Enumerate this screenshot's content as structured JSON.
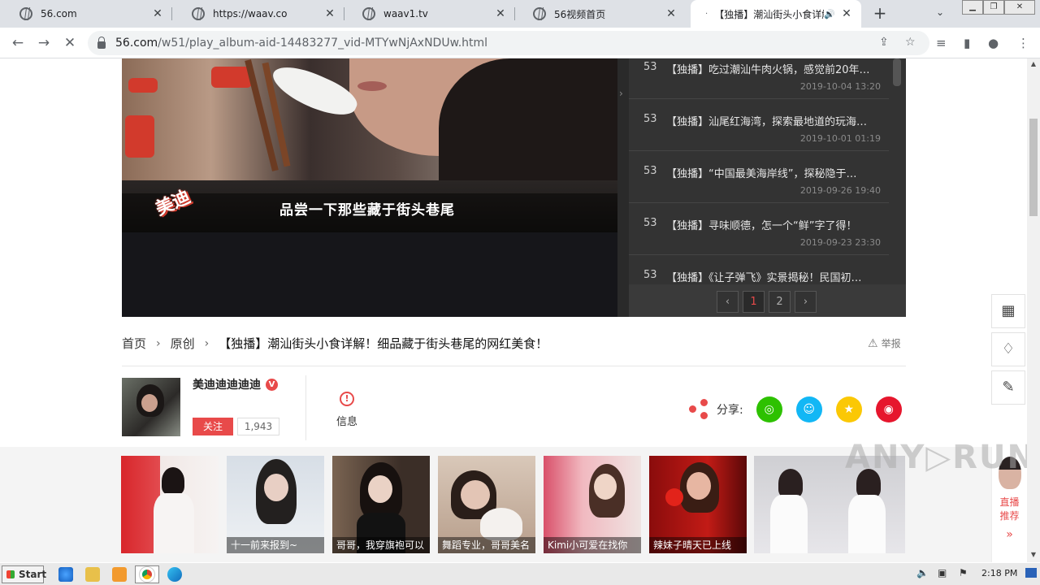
{
  "browser": {
    "tabs": [
      {
        "title": "56.com",
        "active": false
      },
      {
        "title": "https://waav.co",
        "active": false
      },
      {
        "title": "waav1.tv",
        "active": false
      },
      {
        "title": "56视频首页",
        "active": false
      },
      {
        "title": "【独播】潮汕街头小食详解",
        "active": true
      }
    ],
    "url_domain": "56.com",
    "url_path": "/w51/play_album-aid-14483277_vid-MTYwNjAxNDUw.html"
  },
  "video": {
    "caption": "品尝一下那些藏于街头巷尾",
    "logo_text": "美迪"
  },
  "playlist": {
    "items": [
      {
        "num": "53",
        "title": "【独播】吃过潮汕牛肉火锅，感觉前20年…",
        "date": "2019-10-04 13:20"
      },
      {
        "num": "53",
        "title": "【独播】汕尾红海湾，探索最地道的玩海…",
        "date": "2019-10-01 01:19"
      },
      {
        "num": "53",
        "title": "【独播】“中国最美海岸线”，探秘隐于…",
        "date": "2019-09-26 19:40"
      },
      {
        "num": "53",
        "title": "【独播】寻味顺德，怎一个“鲜”字了得！",
        "date": "2019-09-23 23:30"
      },
      {
        "num": "53",
        "title": "【独播】《让子弹飞》实景揭秘！民国初…",
        "date": ""
      }
    ],
    "pager": {
      "prev": "‹",
      "pages": [
        "1",
        "2"
      ],
      "current": "1",
      "next": "›"
    }
  },
  "breadcrumb": {
    "home": "首页",
    "category": "原创",
    "title": "【独播】潮汕街头小食详解！细品藏于街头巷尾的网红美食！",
    "report": "举报"
  },
  "author": {
    "name": "美迪迪迪迪迪",
    "verified_badge": "V",
    "follow_label": "关注",
    "follower_count": "1,943",
    "info_label": "信息"
  },
  "share": {
    "label": "分享:",
    "targets": [
      "wechat-icon",
      "qq-icon",
      "qzone-icon",
      "weibo-icon"
    ]
  },
  "recommend": {
    "thumbnails": [
      {
        "caption": ""
      },
      {
        "caption": "十一前来报到~"
      },
      {
        "caption": "哥哥，我穿旗袍可以"
      },
      {
        "caption": "舞蹈专业，哥哥美名"
      },
      {
        "caption": "Kimi小可爱在找你"
      },
      {
        "caption": "辣妹子晴天已上线"
      },
      {
        "caption": ""
      }
    ],
    "live_label_1": "直播",
    "live_label_2": "推荐",
    "live_more": "»"
  },
  "watermark": "ANY▷RUN",
  "taskbar": {
    "start_label": "Start",
    "clock": "2:18 PM"
  },
  "colors": {
    "accent": "#e84a4a",
    "wechat": "#2dc100",
    "qq": "#12b7f5",
    "qzone": "#fbc805",
    "weibo": "#e6162d"
  }
}
